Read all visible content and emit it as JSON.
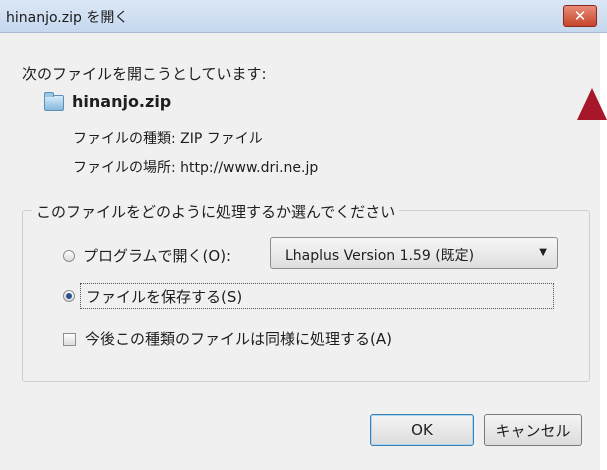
{
  "window": {
    "title": "hinanjo.zip を開く",
    "close_symbol": "✕"
  },
  "dialog": {
    "heading": "次のファイルを開こうとしています:",
    "file_name": "hinanjo.zip",
    "file_type_line": "ファイルの種類: ZIP ファイル",
    "file_location_line": "ファイルの場所: http://www.dri.ne.jp",
    "group_title": "このファイルをどのように処理するか選んでください",
    "option_open_with": {
      "label": "プログラムで開く(O):",
      "selected": false
    },
    "app_select": {
      "value": "Lhaplus Version 1.59 (既定)",
      "arrow": "▼"
    },
    "option_save": {
      "label": "ファイルを保存する(S)",
      "selected": true
    },
    "remember_checkbox": {
      "label": "今後この種類のファイルは同様に処理する(A)",
      "checked": false
    },
    "ok_button": "OK",
    "cancel_button": "キャンセル"
  },
  "colors": {
    "accent_arrow": "#a8162a",
    "close_button": "#c6452c"
  }
}
